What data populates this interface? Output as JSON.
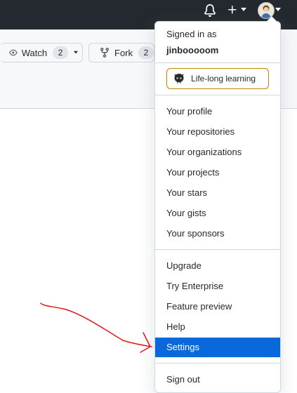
{
  "header": {
    "notifications_icon": "bell-icon",
    "create_icon": "plus-icon",
    "avatar_icon": "avatar"
  },
  "repo_actions": {
    "watch": {
      "label": "Watch",
      "count": "2",
      "icon": "eye-icon"
    },
    "fork": {
      "label": "Fork",
      "count": "2",
      "icon": "repo-forked-icon"
    }
  },
  "user_menu": {
    "signed_in_as": "Signed in as",
    "username": "jinbooooom",
    "status": {
      "text": "Life-long learning",
      "icon": "octocat-icon"
    },
    "group1": [
      "Your profile",
      "Your repositories",
      "Your organizations",
      "Your projects",
      "Your stars",
      "Your gists",
      "Your sponsors"
    ],
    "group2": [
      "Upgrade",
      "Try Enterprise",
      "Feature preview",
      "Help",
      "Settings"
    ],
    "selected_item": "Settings",
    "sign_out": "Sign out"
  },
  "colors": {
    "header_bg": "#24292f",
    "selected_bg": "#0969da",
    "status_border": "#bf8700",
    "annotation": "#e8141b"
  }
}
